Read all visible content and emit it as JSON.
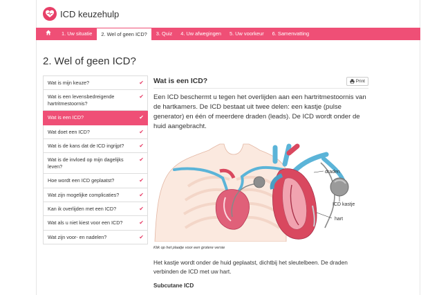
{
  "brand": {
    "name": "ICD keuzehulp"
  },
  "nav": {
    "home_icon": "home-icon",
    "items": [
      {
        "label": "1. Uw situatie"
      },
      {
        "label": "2. Wel of geen ICD?"
      },
      {
        "label": "3. Quiz"
      },
      {
        "label": "4. Uw afwegingen"
      },
      {
        "label": "5. Uw voorkeur"
      },
      {
        "label": "6. Samenvatting"
      }
    ],
    "active_index": 1
  },
  "page": {
    "title": "2. Wel of geen ICD?"
  },
  "sidebar": {
    "items": [
      {
        "label": "Wat is mijn keuze?"
      },
      {
        "label": "Wat is een levensbedreigende hartritmestoornis?"
      },
      {
        "label": "Wat is een ICD?"
      },
      {
        "label": "Wat doet een ICD?"
      },
      {
        "label": "Wat is de kans dat de ICD ingrijpt?"
      },
      {
        "label": "Wat is de invloed op mijn dagelijks leven?"
      },
      {
        "label": "Hoe wordt een ICD geplaatst?"
      },
      {
        "label": "Wat zijn mogelijke complicaties?"
      },
      {
        "label": "Kan ik overlijden met een ICD?"
      },
      {
        "label": "Wat als u niet kiest voor een ICD?"
      },
      {
        "label": "Wat zijn voor- en nadelen?"
      }
    ],
    "active_index": 2,
    "check_glyph": "✔"
  },
  "content": {
    "title": "Wat is een ICD?",
    "print_label": "Print",
    "intro": "Een ICD beschermt u tegen het overlijden aan een hartritmestoornis van de hartkamers. De ICD bestaat uit twee delen: een kastje (pulse generator) en één of meerdere draden (leads). De ICD wordt onder de huid aangebracht.",
    "illustration_labels": {
      "leads": "draden",
      "generator": "ICD kastje",
      "heart": "hart"
    },
    "caption": "Klik op het plaatje voor een grotere versie",
    "body": "Het kastje wordt onder de huid geplaatst, dichtbij het sleutelbeen. De draden verbinden de ICD met uw hart.",
    "subheading": "Subcutane ICD"
  },
  "colors": {
    "accent": "#ef4f76",
    "check": "#e73f68",
    "vessel_blue": "#5bb4d8",
    "heart_red": "#d9485f"
  }
}
